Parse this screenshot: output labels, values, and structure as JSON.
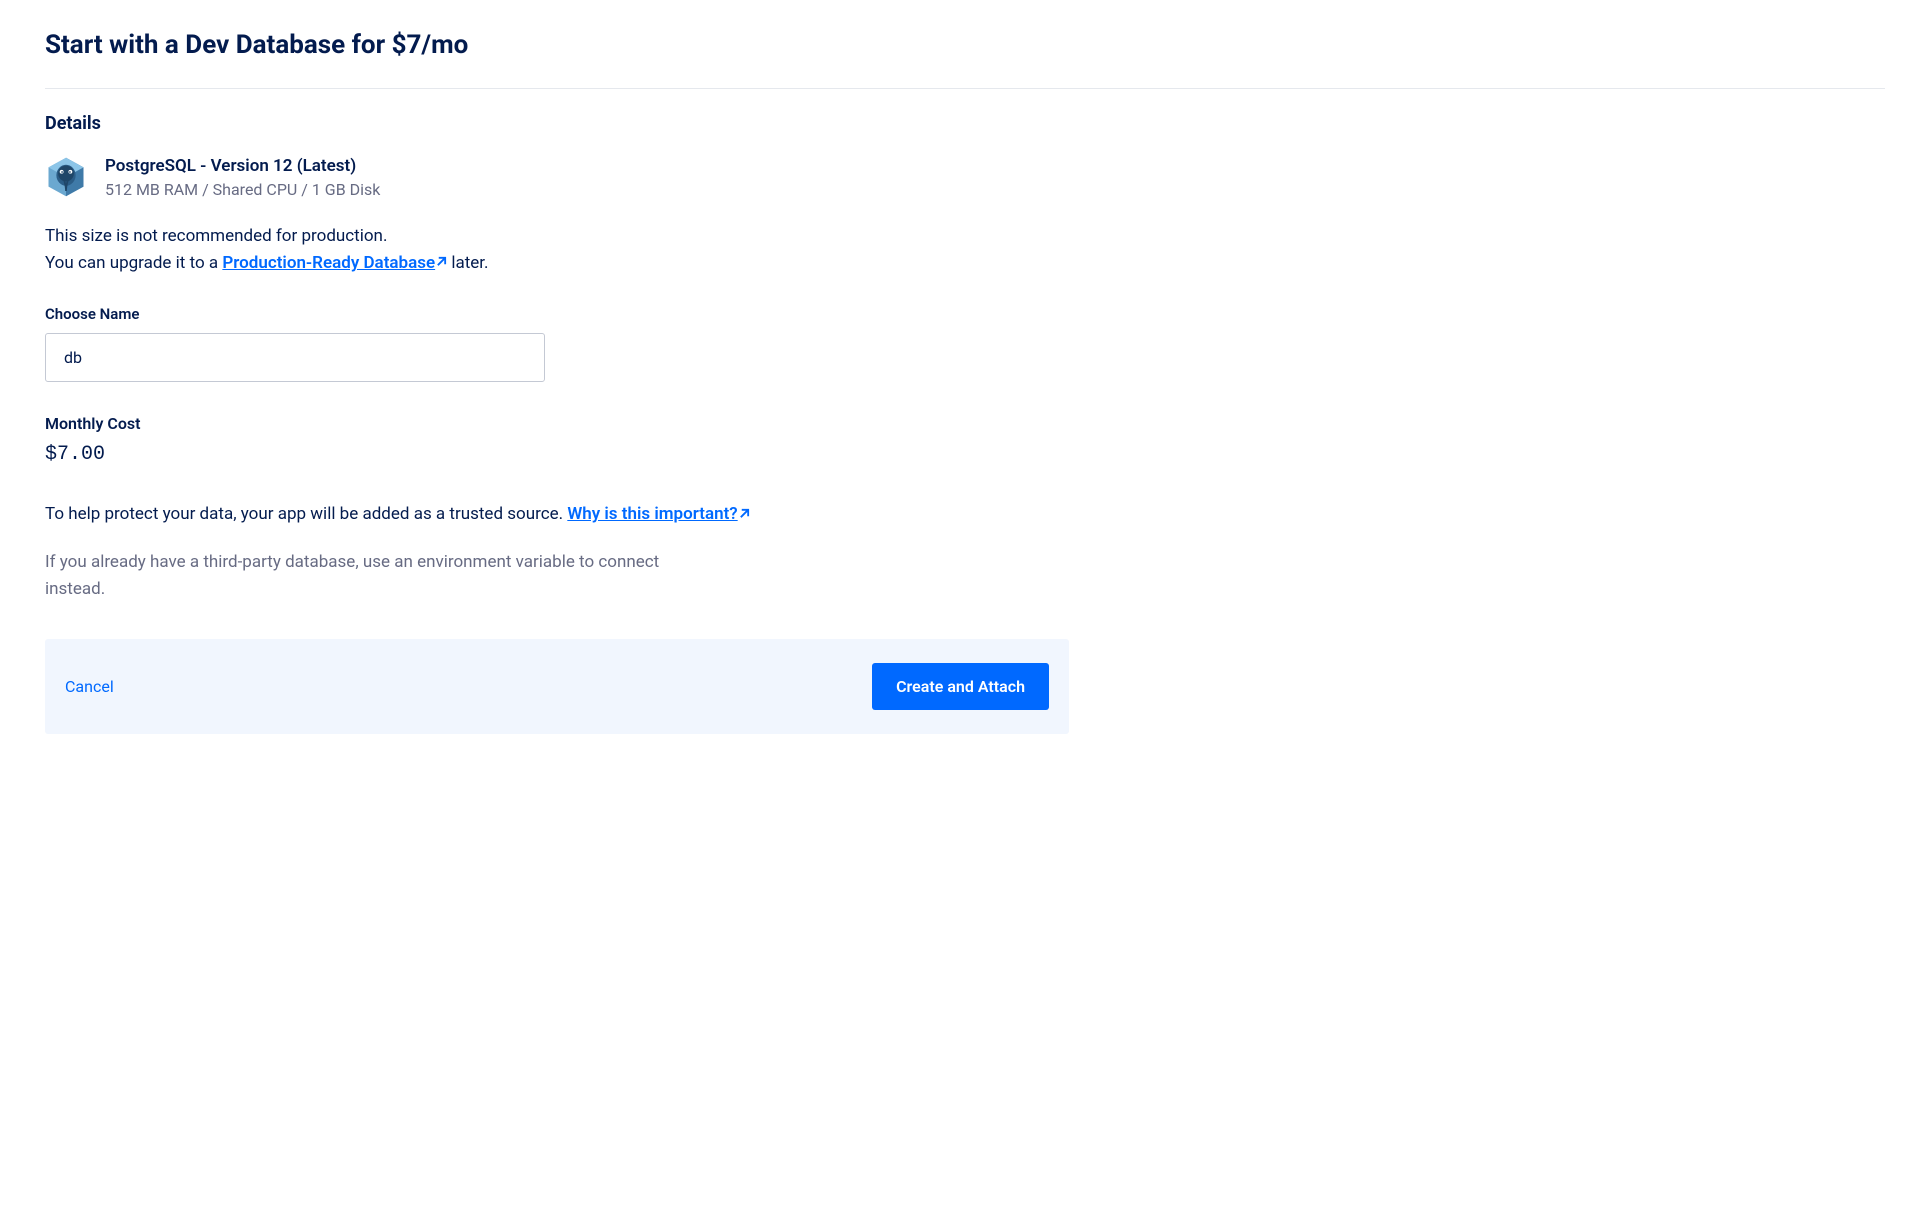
{
  "header": {
    "title": "Start with a Dev Database for $7/mo"
  },
  "details": {
    "heading": "Details",
    "db_title": "PostgreSQL - Version 12 (Latest)",
    "db_specs": "512 MB RAM / Shared CPU / 1 GB Disk",
    "note_line1": "This size is not recommended for production.",
    "note_line2_prefix": "You can upgrade it to a ",
    "note_link": "Production-Ready Database",
    "note_line2_suffix": "  later."
  },
  "form": {
    "name_label": "Choose Name",
    "name_value": "db",
    "cost_label": "Monthly Cost",
    "cost_value": "$7.00"
  },
  "trusted": {
    "text": "To help protect your data, your app will be added as a trusted source.  ",
    "link": "Why is this important?"
  },
  "note": "If you already have a third-party database, use an environment variable to connect instead.",
  "actions": {
    "cancel": "Cancel",
    "submit": "Create and Attach"
  }
}
